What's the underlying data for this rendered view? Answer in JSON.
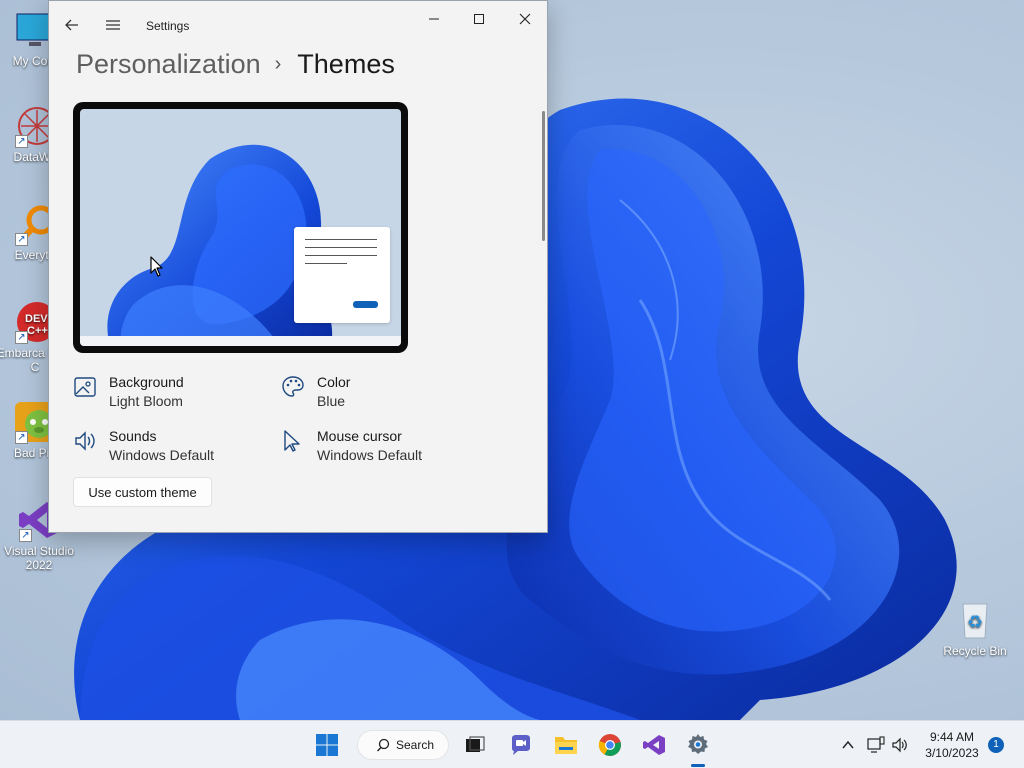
{
  "desktop": {
    "icons": [
      {
        "label": "My Com",
        "icon": "monitor-icon"
      },
      {
        "label": "DataWa",
        "icon": "datawave-icon"
      },
      {
        "label": "Everyth",
        "icon": "search-app-icon"
      },
      {
        "label": "Embarca Dev-C",
        "icon": "devcpp-icon"
      },
      {
        "label": "Bad Pig",
        "icon": "bad-piggies-icon"
      },
      {
        "label": "Visual Studio 2022",
        "icon": "visual-studio-icon"
      },
      {
        "label": "Recycle Bin",
        "icon": "recycle-bin-icon"
      }
    ]
  },
  "window": {
    "title": "Settings",
    "breadcrumb": {
      "parent": "Personalization",
      "separator": "›",
      "current": "Themes"
    },
    "properties": [
      {
        "title": "Background",
        "value": "Light Bloom",
        "icon": "image-icon"
      },
      {
        "title": "Color",
        "value": "Blue",
        "icon": "palette-icon"
      },
      {
        "title": "Sounds",
        "value": "Windows Default",
        "icon": "speaker-icon"
      },
      {
        "title": "Mouse cursor",
        "value": "Windows Default",
        "icon": "cursor-icon"
      }
    ],
    "custom_button": "Use custom theme"
  },
  "taskbar": {
    "search_label": "Search",
    "time": "9:44 AM",
    "date": "3/10/2023",
    "notification_count": "1"
  },
  "colors": {
    "accent": "#0f62b8",
    "bloom_dark": "#0a2db0",
    "bloom_light": "#3a7bff"
  }
}
